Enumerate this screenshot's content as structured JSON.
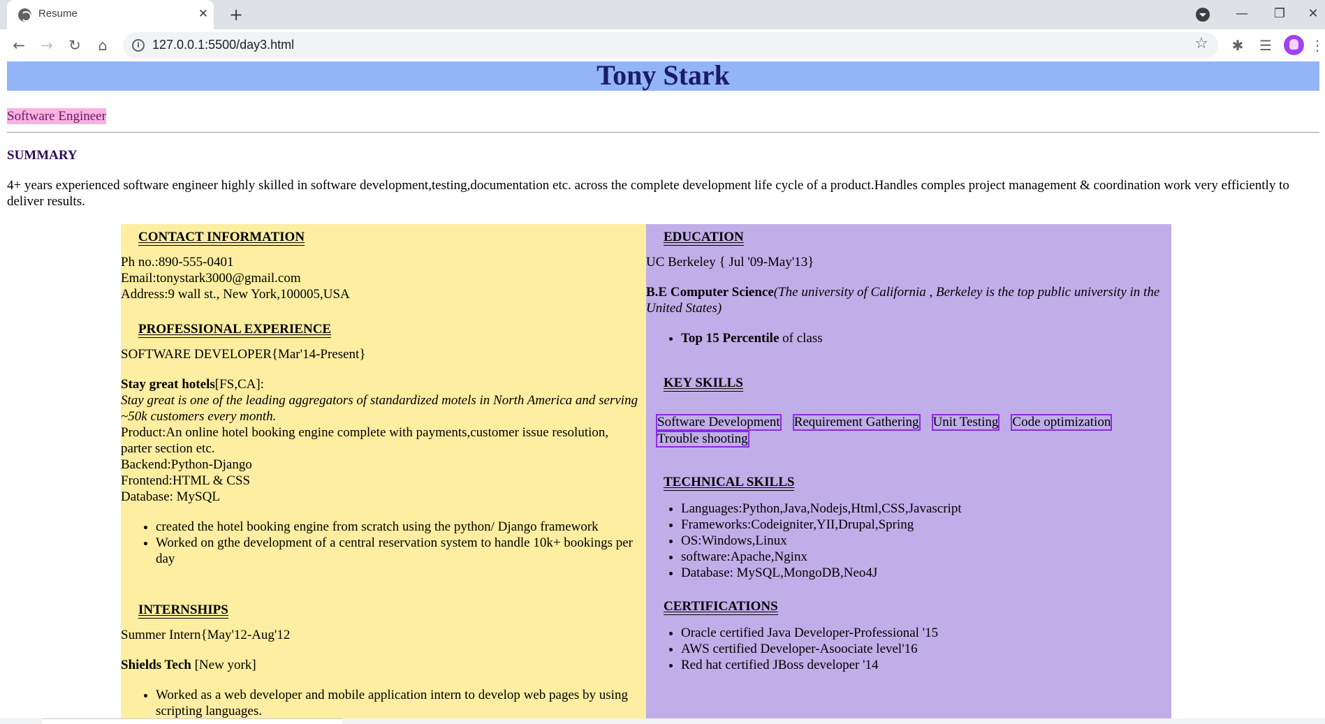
{
  "browser": {
    "tab_title": "Resume",
    "url": "127.0.0.1:5500/day3.html"
  },
  "resume": {
    "name": "Tony Stark",
    "role": "Software Engineer",
    "summary_heading": "SUMMARY",
    "summary_text": "4+ years experienced software engineer highly skilled in software development,testing,documentation etc. across the complete development life cycle of a product.Handles comples project management & coordination work very efficiently to deliver results.",
    "contact": {
      "heading": "CONTACT INFORMATION",
      "phone": "Ph no.:890-555-0401",
      "email": "Email:tonystark3000@gmail.com",
      "address": "Address:9 wall st., New York,100005,USA"
    },
    "experience": {
      "heading": "PROFESSIONAL EXPERIENCE",
      "title": "SOFTWARE DEVELOPER{Mar'14-Present}",
      "company": "Stay great hotels",
      "company_loc": "[FS,CA]:",
      "company_desc": "Stay great is one of the leading aggregators of standardized motels in North America and serving ~50k customers every month.",
      "product": "Product:An online hotel booking engine complete with payments,customer issue resolution, parter section etc.",
      "backend": "Backend:Python-Django",
      "frontend": "Frontend:HTML & CSS",
      "database": "Database: MySQL",
      "bullets": [
        "created the hotel booking engine from scratch using the python/ Django framework",
        "Worked on gthe development of a central reservation system to handle 10k+ bookings per day"
      ]
    },
    "internships": {
      "heading": "INTERNSHIPS",
      "title": "Summer Intern{May'12-Aug'12",
      "company": "Shields Tech",
      "company_loc": " [New york]",
      "bullets": [
        "Worked as a web developer and mobile application intern to develop web pages by using scripting languages."
      ]
    },
    "education": {
      "heading": "EDUCATION",
      "school": "UC Berkeley { Jul '09-May'13}",
      "degree": "B.E Computer Science",
      "degree_desc": "(The university of California , Berkeley is the top public university in the United States)",
      "bullet_bold": "Top 15 Percentile",
      "bullet_rest": " of class"
    },
    "key_skills": {
      "heading": "KEY SKILLS",
      "items": [
        "Software Development",
        "Requirement Gathering",
        "Unit Testing",
        "Code optimization",
        "Trouble shooting"
      ]
    },
    "technical_skills": {
      "heading": "TECHNICAL SKILLS",
      "items": [
        "Languages:Python,Java,Nodejs,Html,CSS,Javascript",
        "Frameworks:Codeigniter,YII,Drupal,Spring",
        "OS:Windows,Linux",
        "software:Apache,Nginx",
        "Database: MySQL,MongoDB,Neo4J"
      ]
    },
    "certifications": {
      "heading": "CERTIFICATIONS",
      "items": [
        "Oracle certified Java Developer-Professional '15",
        "AWS certified Developer-Asoociate level'16",
        "Red hat certified JBoss developer '14"
      ]
    }
  }
}
